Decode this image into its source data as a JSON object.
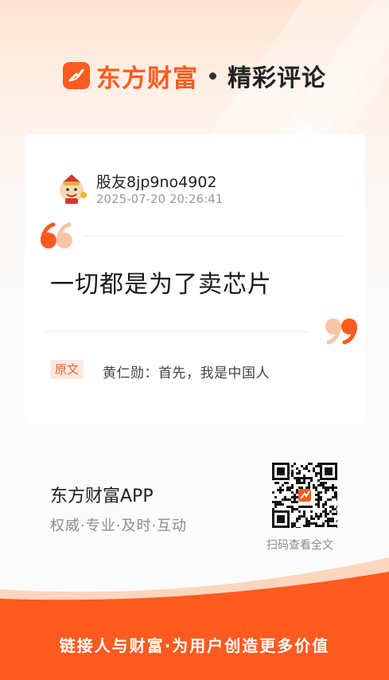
{
  "header": {
    "brand_name": "东方财富",
    "section_title": "精彩评论",
    "logo_icon": "eastmoney-logo-icon",
    "brand_color": "#ff5a1f"
  },
  "comment": {
    "user_name": "股友8jp9no4902",
    "timestamp": "2025-07-20 20:26:41",
    "content": "一切都是为了卖芯片",
    "original_label": "原文",
    "original_text": "黄仁勋：首先，我是中国人"
  },
  "promo": {
    "app_name": "东方财富APP",
    "slogan": "权威·专业·及时·互动",
    "qr_caption": "扫码查看全文",
    "qr_icon": "qr-code-icon"
  },
  "footer": {
    "tagline": "链接人与财富·为用户创造更多价值",
    "color": "#ff5a1f"
  }
}
